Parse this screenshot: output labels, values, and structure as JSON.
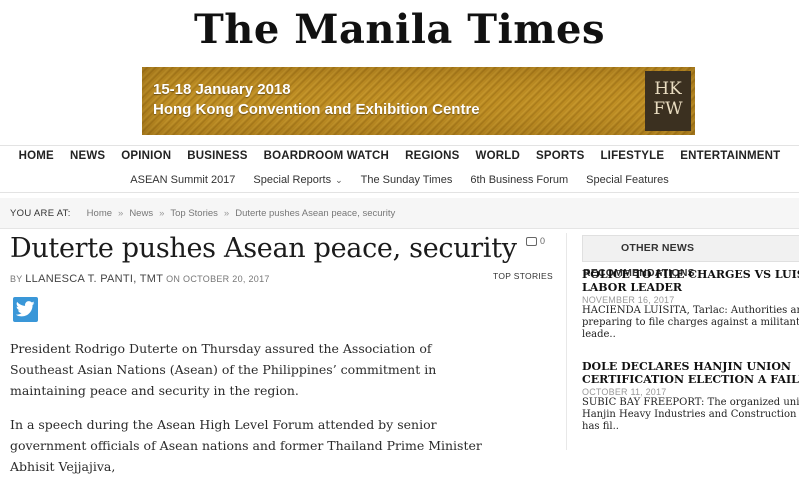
{
  "site": {
    "masthead": "The Manila Times"
  },
  "banner": {
    "line1": "15-18 January 2018",
    "line2": "Hong Kong Convention and Exhibition Centre",
    "logo_top": "HK",
    "logo_bottom": "FW"
  },
  "nav": {
    "primary": [
      "HOME",
      "NEWS",
      "OPINION",
      "BUSINESS",
      "BOARDROOM WATCH",
      "REGIONS",
      "WORLD",
      "SPORTS",
      "LIFESTYLE",
      "ENTERTAINMENT"
    ],
    "secondary": [
      "ASEAN Summit 2017",
      "Special Reports",
      "The Sunday Times",
      "6th Business Forum",
      "Special Features"
    ]
  },
  "breadcrumb": {
    "lead": "YOU ARE AT:",
    "items": [
      "Home",
      "News",
      "Top Stories",
      "Duterte pushes Asean peace, security"
    ]
  },
  "article": {
    "title": "Duterte pushes Asean peace, security",
    "comment_count": "0",
    "by_prefix": "BY",
    "author": "LLANESCA T. PANTI, TMT",
    "date_prefix": "ON",
    "date": "OCTOBER 20, 2017",
    "category": "TOP STORIES",
    "share_icon": "twitter-icon",
    "paragraphs": [
      "President Rodrigo Duterte on Thursday assured the Association of Southeast Asian Nations (Asean) of the Philippines’ commitment in maintaining peace and security in the region.",
      "In a speech during the Asean High Level Forum attended by senior government officials of Asean nations and former Thailand Prime Minister Abhisit Vejjajiva,"
    ]
  },
  "sidebar": {
    "heading": "OTHER NEWS RECOMMENDATIONS",
    "items": [
      {
        "headline_line1": "POLICE TO FILE CHARGES VS LUISITA",
        "headline_line2": "LABOR LEADER",
        "date": "NOVEMBER 16, 2017",
        "excerpt_line1": "HACIENDA LUISITA, Tarlac: Authorities are",
        "excerpt_line2": "preparing to file charges against a militant grou",
        "excerpt_line3": "leade.."
      },
      {
        "headline_line1": "DOLE DECLARES HANJIN UNION",
        "headline_line2": "CERTIFICATION ELECTION A FAILURE",
        "date": "OCTOBER 11, 2017",
        "excerpt_line1": "SUBIC BAY FREEPORT: The organized union",
        "excerpt_line2": "Hanjin Heavy Industries and Construction (HH",
        "excerpt_line3": "has fil.."
      }
    ]
  }
}
